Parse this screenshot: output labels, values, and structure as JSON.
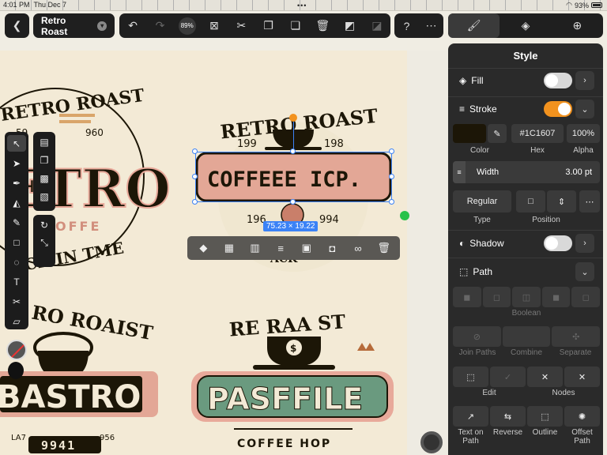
{
  "status": {
    "time": "4:01 PM",
    "date": "Thu Dec 7",
    "battery": "93%"
  },
  "document": {
    "title": "Retro Roast",
    "zoom": "89%"
  },
  "selection": {
    "size": "75.23 × 19.22"
  },
  "canvas": {
    "logo1": {
      "top": "RETRO ROAST",
      "n1": "59",
      "n2": "960",
      "big": "ETRO",
      "sub": "OFFE",
      "bottom": "CK IN TME"
    },
    "logo2": {
      "top": "RETRO ROAST",
      "n1": "199",
      "n2": "198",
      "banner": "COFFEEE ICP.",
      "n3": "196",
      "n4": "994",
      "bottom": "ACK"
    },
    "logo3": {
      "top": "RO ROAIST",
      "big": "BASTRO",
      "n1": "LA7",
      "n2": "956",
      "plate": "9941"
    },
    "logo4": {
      "top": "RE RAA ST",
      "big": "PASFFILE",
      "sub": "COFFEE HOP"
    }
  },
  "panel": {
    "title": "Style",
    "fill": {
      "label": "Fill",
      "on": false
    },
    "stroke": {
      "label": "Stroke",
      "on": true,
      "hex": "#1C1607",
      "alpha": "100%",
      "color_label": "Color",
      "hex_label": "Hex",
      "alpha_label": "Alpha",
      "width_label": "Width",
      "width_value": "3.00 pt",
      "type_value": "Regular",
      "type_label": "Type",
      "position_label": "Position"
    },
    "shadow": {
      "label": "Shadow",
      "on": false
    },
    "path": {
      "label": "Path",
      "boolean_label": "Boolean",
      "join_paths": "Join Paths",
      "combine": "Combine",
      "separate": "Separate",
      "edit": "Edit",
      "nodes": "Nodes",
      "text_on_path": "Text on Path",
      "reverse": "Reverse",
      "outline": "Outline",
      "offset_path": "Offset Path"
    }
  },
  "colors": {
    "accent": "#f2921e",
    "selection": "#3b82f6",
    "stroke_color": "#1C1607",
    "panel_bg": "#2a2a2a"
  }
}
